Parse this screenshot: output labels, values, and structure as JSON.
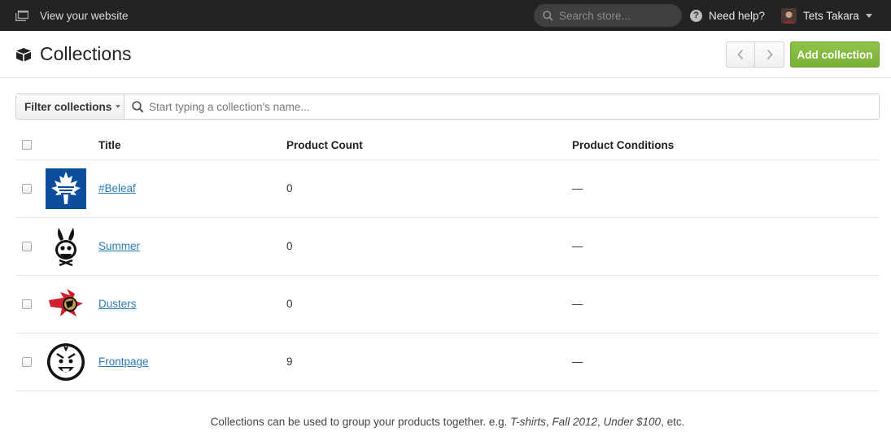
{
  "topbar": {
    "view_site_label": "View your website",
    "search_placeholder": "Search store...",
    "help_label": "Need help?",
    "user_name": "Tets Takara"
  },
  "header": {
    "title": "Collections",
    "add_button_label": "Add collection"
  },
  "filter": {
    "button_label": "Filter collections",
    "search_placeholder": "Start typing a collection's name..."
  },
  "table": {
    "columns": {
      "title": "Title",
      "count": "Product Count",
      "conditions": "Product Conditions"
    },
    "rows": [
      {
        "title": "#Beleaf",
        "count": "0",
        "conditions": "—",
        "thumb": "maple-leaf-logo"
      },
      {
        "title": "Summer",
        "count": "0",
        "conditions": "—",
        "thumb": "bunny-face-logo"
      },
      {
        "title": "Dusters",
        "count": "0",
        "conditions": "—",
        "thumb": "senator-logo"
      },
      {
        "title": "Frontpage",
        "count": "9",
        "conditions": "—",
        "thumb": "round-face-logo"
      }
    ]
  },
  "footnote": {
    "prefix": "Collections can be used to group your products together. e.g. ",
    "ex1": "T-shirts",
    "sep1": ", ",
    "ex2": "Fall 2012",
    "sep2": ", ",
    "ex3": "Under $100",
    "suffix": ", etc."
  },
  "colors": {
    "topbar": "#232323",
    "accent_green": "#80b73b",
    "link": "#2a7ab8",
    "leafs_blue": "#0a4d9c"
  }
}
